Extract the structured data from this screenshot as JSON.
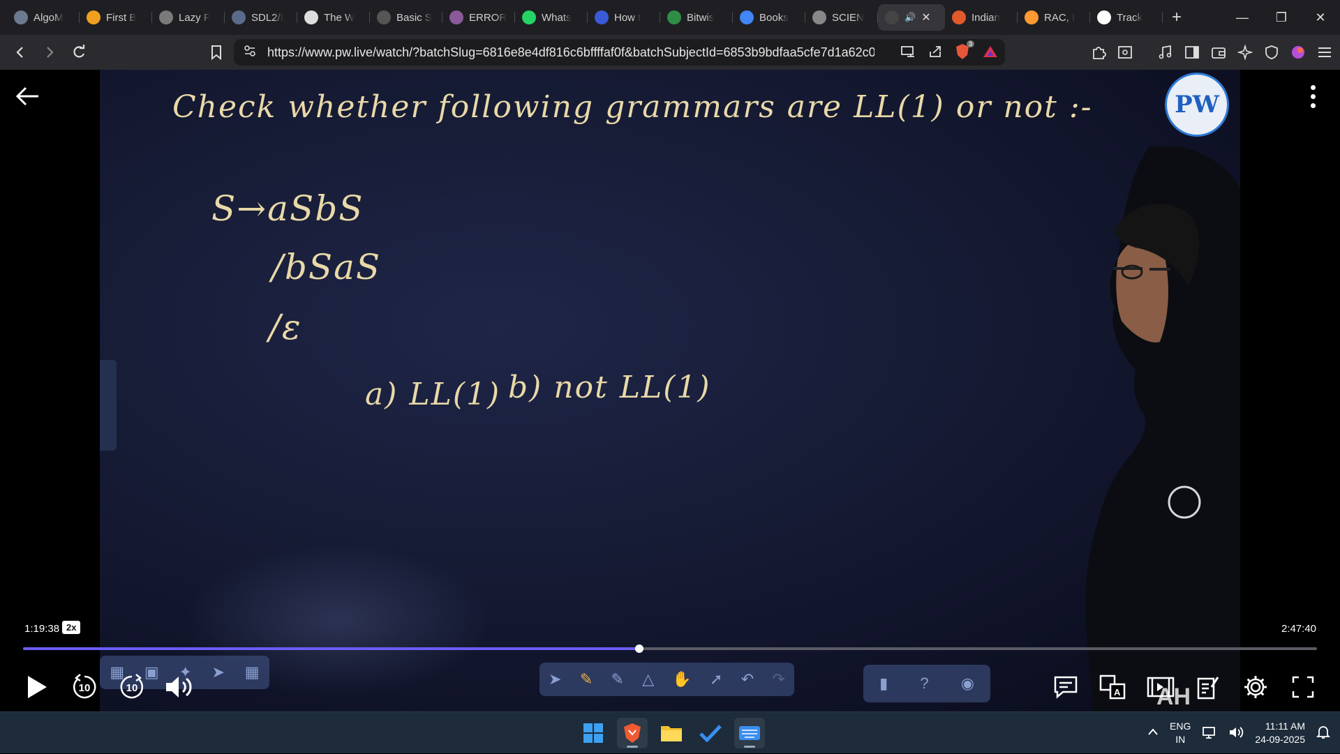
{
  "browser": {
    "tabs": [
      {
        "label": "AlgoM",
        "icon": "algomap-icon",
        "color": "#6b7a8f"
      },
      {
        "label": "First B",
        "icon": "first-bad-version-icon",
        "color": "#f0a020"
      },
      {
        "label": "Lazy F",
        "icon": "globe-icon",
        "color": "#7a7a7a"
      },
      {
        "label": "SDL2/I",
        "icon": "globe-icon",
        "color": "#5a6a8a"
      },
      {
        "label": "The W",
        "icon": "wikipedia-icon",
        "color": "#dddddd"
      },
      {
        "label": "Basic S",
        "icon": "ascii-icon",
        "color": "#555555"
      },
      {
        "label": "ERROR",
        "icon": "error-site-icon",
        "color": "#8a5a9a"
      },
      {
        "label": "Whats",
        "icon": "whatsapp-icon",
        "color": "#25d366"
      },
      {
        "label": "How t",
        "icon": "shield-site-icon",
        "color": "#3a5ad8"
      },
      {
        "label": "Bitwis",
        "icon": "gfg-icon",
        "color": "#2f8d46"
      },
      {
        "label": "Books",
        "icon": "google-icon",
        "color": "#4285f4"
      },
      {
        "label": "SCIEN",
        "icon": "globe-icon",
        "color": "#888888"
      },
      {
        "label": "",
        "icon": "speaker-icon",
        "color": "#444444",
        "active": true
      },
      {
        "label": "Indian",
        "icon": "indian-rail-icon",
        "color": "#e05a2a"
      },
      {
        "label": "RAC, I",
        "icon": "india-flag-icon",
        "color": "#ff9933"
      },
      {
        "label": "Track",
        "icon": "amazon-icon",
        "color": "#ffffff"
      }
    ],
    "url": "https://www.pw.live/watch/?batchSlug=6816e8e4df816c6bffffaf0f&batchSubjectId=6853b9bdfaa5cfe7d1a62c0...",
    "shield_count": "3"
  },
  "lecture": {
    "heading": "Check whether following grammars are LL(1) or not :-",
    "line1": "S→aSbS",
    "line2": "/bSaS",
    "line3": "/ε",
    "option_a": "a) LL(1)",
    "option_b": "b) not LL(1)",
    "logo": "PW",
    "shirt_letters": "AH"
  },
  "player": {
    "current_time": "1:19:38",
    "speed": "2x",
    "total_time": "2:47:40",
    "progress_fraction": 0.476,
    "skip_back": "10",
    "skip_forward": "10"
  },
  "taskbar": {
    "lang_top": "ENG",
    "lang_bottom": "IN",
    "time": "11:11 AM",
    "date": "24-09-2025"
  }
}
